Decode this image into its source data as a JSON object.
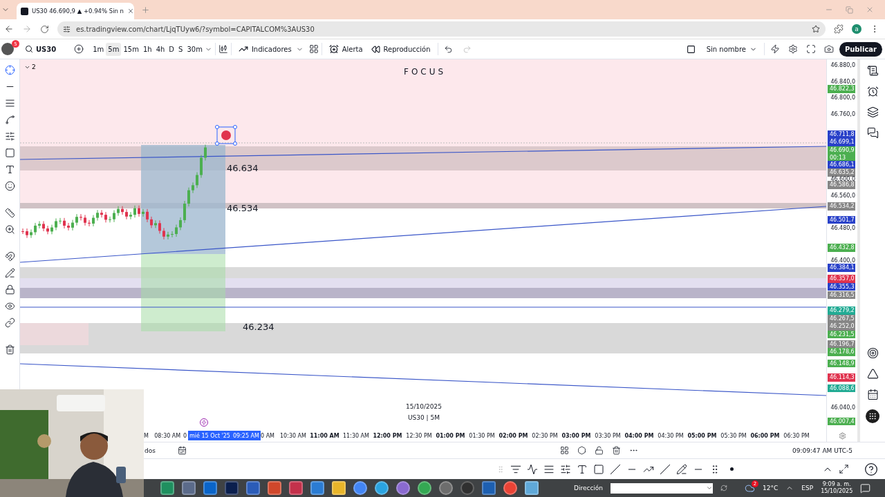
{
  "browser": {
    "tab_title": "US30 46.690,9 ▲ +0.94% Sin n",
    "url": "es.tradingview.com/chart/LjqTUyw6/?symbol=CAPITALCOM%3AUS30",
    "profile": "a"
  },
  "toolbar": {
    "badge": "5",
    "symbol": "US30",
    "intervals": [
      {
        "label": "1m",
        "selected": false
      },
      {
        "label": "5m",
        "selected": true
      },
      {
        "label": "15m",
        "selected": false
      },
      {
        "label": "1h",
        "selected": false
      },
      {
        "label": "4h",
        "selected": false
      },
      {
        "label": "D",
        "selected": false
      },
      {
        "label": "S",
        "selected": false
      },
      {
        "label": "30m",
        "selected": false
      }
    ],
    "indicators": "Indicadores",
    "alert": "Alerta",
    "replay": "Reproducción",
    "layout_name": "Sin nombre",
    "publish": "Publicar"
  },
  "chart": {
    "collapse_count": "2",
    "title": "FOCUS",
    "levels": [
      {
        "text": "46.634"
      },
      {
        "text": "46.534"
      },
      {
        "text": "46.234"
      }
    ],
    "footer_date": "15/10/2025",
    "footer_symbol": "US30 | 5M"
  },
  "price_axis": [
    {
      "text": "46.880,0",
      "kind": "tick"
    },
    {
      "text": "46.840,0",
      "kind": "tick"
    },
    {
      "text": "46.822,3",
      "kind": "tag",
      "color": "#4caf50"
    },
    {
      "text": "46.800,0",
      "kind": "tick"
    },
    {
      "text": "46.760,0",
      "kind": "tick"
    },
    {
      "text": "46.711,8",
      "kind": "tag",
      "color": "#2941c9"
    },
    {
      "text": "46.699,1",
      "kind": "tag",
      "color": "#2941c9"
    },
    {
      "text": "46.690,9",
      "kind": "tag",
      "color": "#4caf50",
      "countdown": "00:13"
    },
    {
      "text": "46.686,1",
      "kind": "tag",
      "color": "#2941c9"
    },
    {
      "text": "46.635,2",
      "kind": "tag",
      "color": "#868686"
    },
    {
      "text": "46.600,0",
      "kind": "tick"
    },
    {
      "text": "46.586,8",
      "kind": "tag",
      "color": "#868686"
    },
    {
      "text": "46.560,0",
      "kind": "tick"
    },
    {
      "text": "46.534,2",
      "kind": "tag",
      "color": "#868686"
    },
    {
      "text": "46.501,7",
      "kind": "tag",
      "color": "#2941c9"
    },
    {
      "text": "46.480,0",
      "kind": "tick"
    },
    {
      "text": "46.432,8",
      "kind": "tag",
      "color": "#4caf50"
    },
    {
      "text": "46.400,0",
      "kind": "tick"
    },
    {
      "text": "46.384,1",
      "kind": "tag",
      "color": "#2941c9"
    },
    {
      "text": "46.357,0",
      "kind": "tag",
      "color": "#e0344f"
    },
    {
      "text": "46.355,3",
      "kind": "tag",
      "color": "#2941c9"
    },
    {
      "text": "46.316,5",
      "kind": "tag",
      "color": "#868686"
    },
    {
      "text": "46.279,2",
      "kind": "tag",
      "color": "#22ab94"
    },
    {
      "text": "46.267,5",
      "kind": "tag",
      "color": "#868686"
    },
    {
      "text": "46.252,0",
      "kind": "tag",
      "color": "#868686"
    },
    {
      "text": "46.231,5",
      "kind": "tag",
      "color": "#4caf50"
    },
    {
      "text": "46.196,7",
      "kind": "tag",
      "color": "#868686"
    },
    {
      "text": "46.178,6",
      "kind": "tag",
      "color": "#4caf50"
    },
    {
      "text": "46.148,9",
      "kind": "tag",
      "color": "#4caf50"
    },
    {
      "text": "46.114,3",
      "kind": "tag",
      "color": "#e0344f"
    },
    {
      "text": "46.088,6",
      "kind": "tag",
      "color": "#22ab94"
    },
    {
      "text": "46.040,0",
      "kind": "tick"
    },
    {
      "text": "46.007,4",
      "kind": "tag",
      "color": "#4caf50"
    }
  ],
  "time_axis": {
    "before": [
      {
        "text": "M",
        "bold": false
      },
      {
        "text": "08:30 AM",
        "bold": false
      },
      {
        "text": "0",
        "bold": false
      }
    ],
    "cursor": {
      "date": "mié 15 Oct '25",
      "time": "09:25 AM"
    },
    "after": [
      {
        "text": "0 AM",
        "bold": false
      },
      {
        "text": "10:30 AM",
        "bold": false
      },
      {
        "text": "11:00 AM",
        "bold": true
      },
      {
        "text": "11:30 AM",
        "bold": false
      },
      {
        "text": "12:00 PM",
        "bold": true
      },
      {
        "text": "12:30 PM",
        "bold": false
      },
      {
        "text": "01:00 PM",
        "bold": true
      },
      {
        "text": "01:30 PM",
        "bold": false
      },
      {
        "text": "02:00 PM",
        "bold": true
      },
      {
        "text": "02:30 PM",
        "bold": false
      },
      {
        "text": "03:00 PM",
        "bold": true
      },
      {
        "text": "03:30 PM",
        "bold": false
      },
      {
        "text": "04:00 PM",
        "bold": true
      },
      {
        "text": "04:30 PM",
        "bold": false
      },
      {
        "text": "05:00 PM",
        "bold": true
      },
      {
        "text": "05:30 PM",
        "bold": false
      },
      {
        "text": "06:00 PM",
        "bold": true
      },
      {
        "text": "06:30 PM",
        "bold": false
      }
    ]
  },
  "bottom_bar": {
    "left_text": "dos",
    "clock": "09:09:47 AM UTC-5"
  },
  "taskbar": {
    "address_label": "Dirección",
    "weather_badge": "2",
    "temperature": "12°C",
    "language": "ESP",
    "time": "9:09 a. m.",
    "date": "15/10/2025"
  }
}
